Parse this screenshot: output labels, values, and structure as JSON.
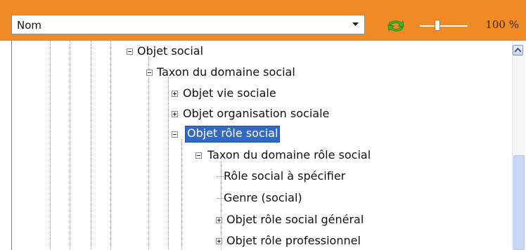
{
  "toolbar": {
    "sort_field": "Nom",
    "zoom": "100 %",
    "zoom_level": 0.35,
    "accent_color": "#f08a24",
    "refresh_icon": "refresh-icon",
    "dropdown_icon": "chevron-down-icon"
  },
  "tree": {
    "selected_color": "#3169c6",
    "nodes": [
      {
        "label": "Objet social",
        "state": "expanded",
        "depth": 0
      },
      {
        "label": "Taxon du domaine social",
        "state": "expanded",
        "depth": 1
      },
      {
        "label": "Objet vie sociale",
        "state": "collapsed",
        "depth": 2
      },
      {
        "label": "Objet organisation sociale",
        "state": "collapsed",
        "depth": 2
      },
      {
        "label": "Objet rôle social",
        "state": "expanded",
        "depth": 2,
        "selected": true
      },
      {
        "label": "Taxon du domaine  rôle social",
        "state": "expanded",
        "depth": 3
      },
      {
        "label": "Rôle social à spécifier",
        "state": "leaf",
        "depth": 4
      },
      {
        "label": "Genre (social)",
        "state": "leaf",
        "depth": 4
      },
      {
        "label": "Objet rôle social général",
        "state": "collapsed",
        "depth": 4
      },
      {
        "label": "Objet rôle professionnel",
        "state": "collapsed",
        "depth": 4
      }
    ]
  }
}
